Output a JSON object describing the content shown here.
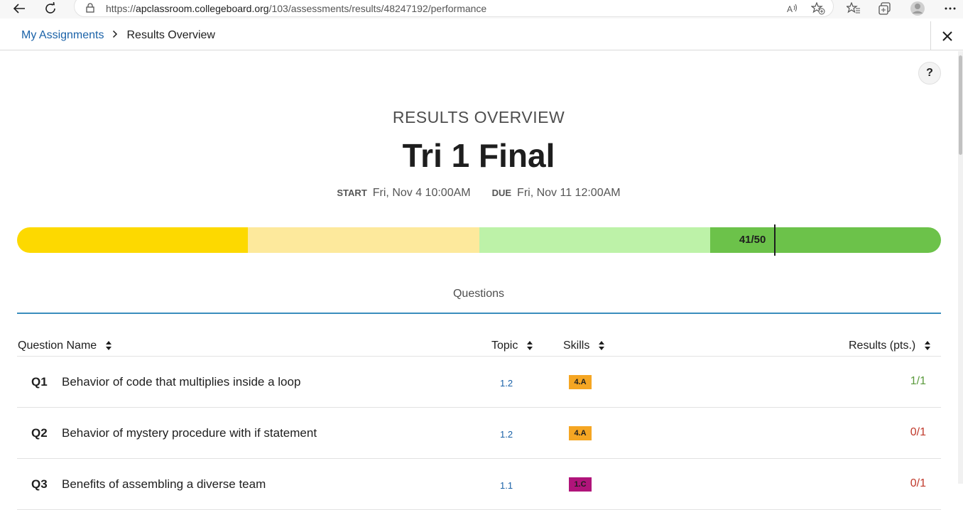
{
  "browser": {
    "url_prefix": "https://",
    "url_host": "apclassroom.collegeboard.org",
    "url_path": "/103/assessments/results/48247192/performance"
  },
  "breadcrumb": {
    "parent": "My Assignments",
    "separator": ">",
    "current": "Results Overview"
  },
  "help_label": "?",
  "header": {
    "overline": "RESULTS OVERVIEW",
    "title": "Tri 1 Final",
    "start_label": "START",
    "start_value": "Fri, Nov 4 10:00AM",
    "due_label": "DUE",
    "due_value": "Fri, Nov 11 12:00AM"
  },
  "score": {
    "label": "41/50",
    "earned": 41,
    "total": 50,
    "bands": [
      {
        "color": "#fdd900",
        "fraction": 0.25
      },
      {
        "color": "#fde99c",
        "fraction": 0.25
      },
      {
        "color": "#bdf2a8",
        "fraction": 0.25
      },
      {
        "color": "#6cc24a",
        "fraction": 0.25
      }
    ]
  },
  "tabs": {
    "questions": "Questions"
  },
  "table": {
    "columns": {
      "name": "Question Name",
      "topic": "Topic",
      "skills": "Skills",
      "results": "Results (pts.)"
    },
    "rows": [
      {
        "id": "Q1",
        "name": "Behavior of code that multiplies inside a loop",
        "topic": "1.2",
        "skill": "4.A",
        "skill_color": "#f5a623",
        "result": "1/1",
        "result_color": "#5a9a3c"
      },
      {
        "id": "Q2",
        "name": "Behavior of mystery procedure with if statement",
        "topic": "1.2",
        "skill": "4.A",
        "skill_color": "#f5a623",
        "result": "0/1",
        "result_color": "#c0392b"
      },
      {
        "id": "Q3",
        "name": "Benefits of assembling a diverse team",
        "topic": "1.1",
        "skill": "1.C",
        "skill_color": "#b0147a",
        "result": "0/1",
        "result_color": "#c0392b"
      }
    ]
  }
}
